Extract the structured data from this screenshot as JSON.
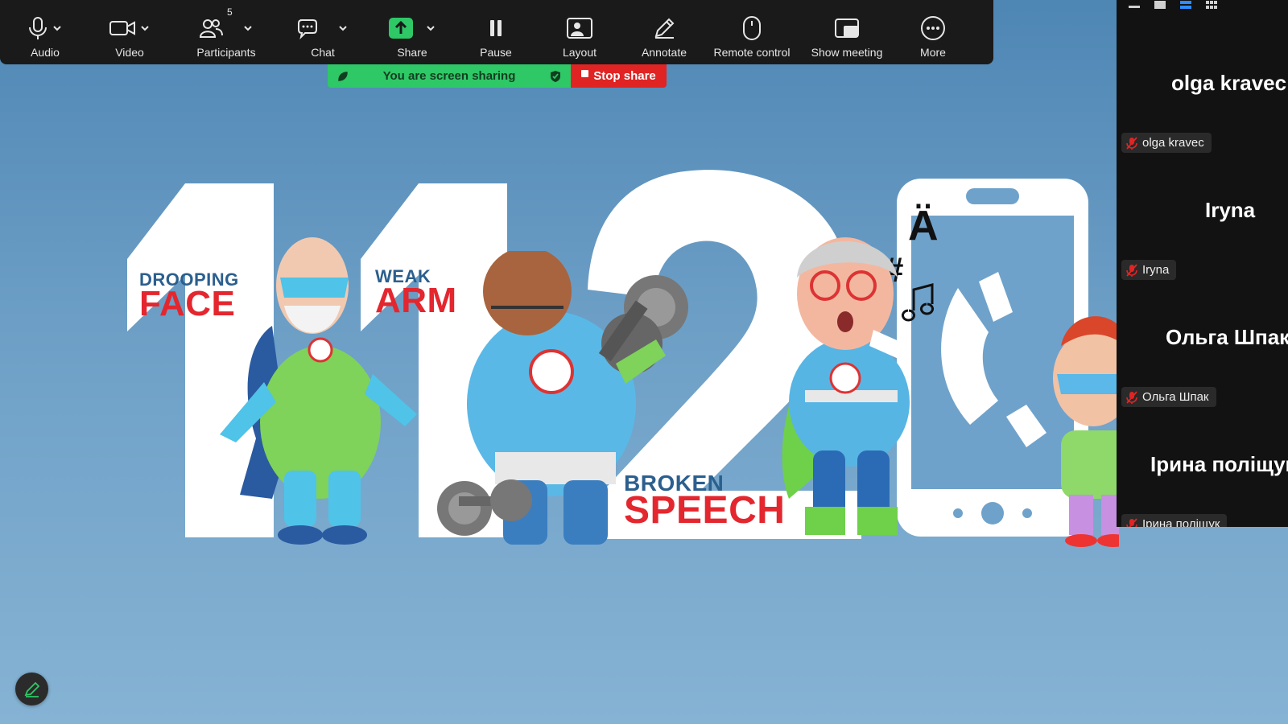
{
  "toolbar": {
    "items": [
      {
        "id": "audio",
        "label": "Audio",
        "icon": "microphone-icon",
        "has_caret": true
      },
      {
        "id": "video",
        "label": "Video",
        "icon": "video-camera-icon",
        "has_caret": true
      },
      {
        "id": "participants",
        "label": "Participants",
        "icon": "participants-icon",
        "has_caret": true,
        "badge": "5"
      },
      {
        "id": "chat",
        "label": "Chat",
        "icon": "chat-icon",
        "has_caret": true
      },
      {
        "id": "share",
        "label": "Share",
        "icon": "share-screen-icon",
        "has_caret": true,
        "accent": "#2ec866"
      },
      {
        "id": "pause",
        "label": "Pause",
        "icon": "pause-icon"
      },
      {
        "id": "layout",
        "label": "Layout",
        "icon": "layout-icon"
      },
      {
        "id": "annotate",
        "label": "Annotate",
        "icon": "pencil-icon"
      },
      {
        "id": "remote",
        "label": "Remote control",
        "icon": "mouse-icon"
      },
      {
        "id": "show_meeting",
        "label": "Show meeting",
        "icon": "show-meeting-icon"
      },
      {
        "id": "more",
        "label": "More",
        "icon": "more-icon"
      }
    ]
  },
  "share_bar": {
    "status_text": "You are screen sharing",
    "status_color": "#2ec866",
    "stop_label": "Stop share",
    "stop_color": "#e02424"
  },
  "slide": {
    "digits": "112",
    "captions": [
      {
        "small": "DROOPING",
        "big": "FACE"
      },
      {
        "small": "WEAK",
        "big": "ARM"
      },
      {
        "small": "BROKEN",
        "big": "SPEECH"
      }
    ],
    "phone_glyphs": [
      "Ä",
      "#"
    ]
  },
  "participants": [
    {
      "display_name": "olga kravec",
      "chip_name": "olga kravec",
      "muted": true
    },
    {
      "display_name": "Iryna",
      "chip_name": "Iryna",
      "muted": true
    },
    {
      "display_name": "Ольга Шпак",
      "chip_name": "Ольга Шпак",
      "muted": true
    },
    {
      "display_name": "Ірина поліщук",
      "chip_name": "Ірина поліщук",
      "muted": true
    }
  ],
  "view_controls": [
    "minimize-icon",
    "speaker-view-icon",
    "strip-view-icon",
    "gallery-view-icon"
  ],
  "colors": {
    "toolbar_bg": "#1a1a1a",
    "panel_bg": "#121212",
    "muted_red": "#e02424",
    "slide_bg": "#6d9fc6",
    "caption_red": "#e4262e",
    "caption_blue": "#2b5f8e"
  }
}
